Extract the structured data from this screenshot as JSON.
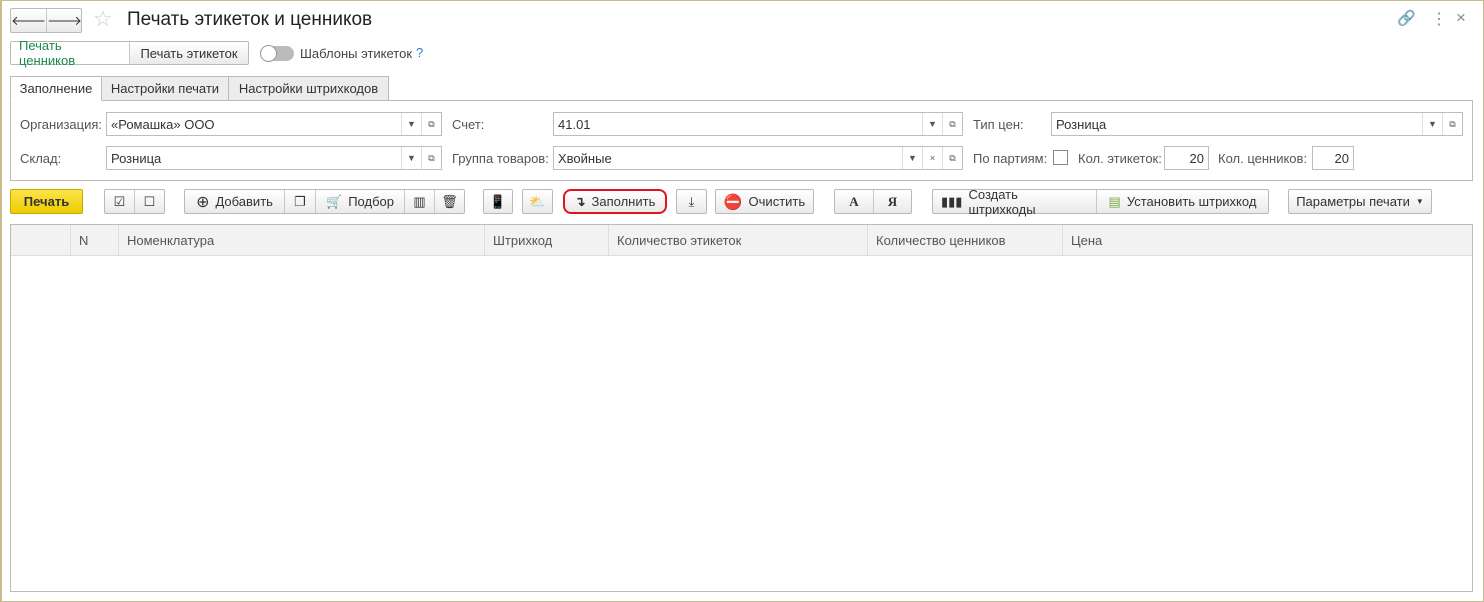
{
  "title": "Печать этикеток и ценников",
  "mode_buttons": {
    "price_tags": "Печать ценников",
    "labels": "Печать этикеток"
  },
  "templates_toggle": {
    "label": "Шаблоны этикеток",
    "help": "?",
    "on": false
  },
  "tabs": [
    "Заполнение",
    "Настройки печати",
    "Настройки штрихкодов"
  ],
  "form": {
    "organization": {
      "label": "Организация:",
      "value": "«Ромашка» ООО"
    },
    "account": {
      "label": "Счет:",
      "value": "41.01"
    },
    "price_type": {
      "label": "Тип цен:",
      "value": "Розница"
    },
    "warehouse": {
      "label": "Склад:",
      "value": "Розница"
    },
    "product_group": {
      "label": "Группа товаров:",
      "value": "Хвойные"
    },
    "by_batches": {
      "label": "По партиям:",
      "checked": false
    },
    "labels_count": {
      "label": "Кол. этикеток:",
      "value": "20"
    },
    "tags_count": {
      "label": "Кол. ценников:",
      "value": "20"
    }
  },
  "toolbar": {
    "print": "Печать",
    "add": "Добавить",
    "pick": "Подбор",
    "fill": "Заполнить",
    "clear": "Очистить",
    "font_a": "A",
    "font_ya": "Я",
    "create_barcodes": "Создать штрихкоды",
    "set_barcode": "Установить штрихкод",
    "print_params": "Параметры печати"
  },
  "table": {
    "columns": [
      "N",
      "Номенклатура",
      "Штрихкод",
      "Количество этикеток",
      "Количество ценников",
      "Цена"
    ],
    "rows": []
  },
  "colors": {
    "print_button": "#f5d813",
    "highlight": "#e0141e",
    "active_mode": "#1a8a4a",
    "help": "#2a7bd4"
  }
}
